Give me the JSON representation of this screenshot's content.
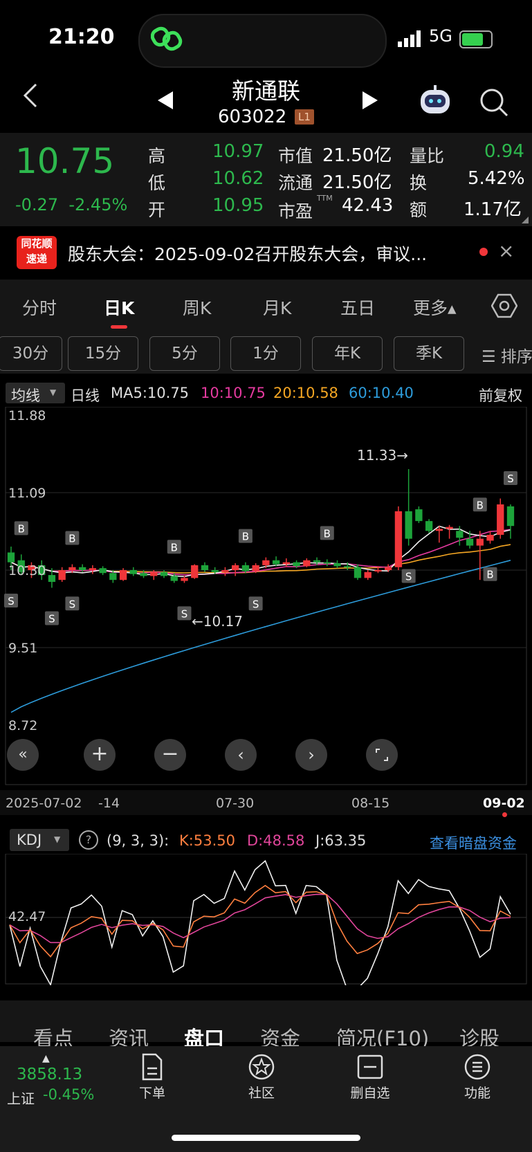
{
  "status_bar": {
    "time": "21:20",
    "network": "5G"
  },
  "header": {
    "title": "新通联",
    "code": "603022",
    "level_badge": "L1"
  },
  "quote": {
    "price": "10.75",
    "change": "-0.27",
    "change_pct": "-2.45%",
    "high_label": "高",
    "high": "10.97",
    "low_label": "低",
    "low": "10.62",
    "open_label": "开",
    "open": "10.95",
    "mcap_label": "市值",
    "mcap": "21.50亿",
    "float_label": "流通",
    "float": "21.50亿",
    "pe_label": "市盈",
    "pe_sup": "TTM",
    "pe": "42.43",
    "vol_ratio_label": "量比",
    "vol_ratio": "0.94",
    "turnover_label": "换",
    "turnover": "5.42%",
    "amount_label": "额",
    "amount": "1.17亿"
  },
  "news": {
    "logo_line1": "同花顺",
    "logo_line2": "速递",
    "text": "股东大会：2025-09-02召开股东大会，审议..."
  },
  "period_tabs": [
    "分时",
    "日K",
    "周K",
    "月K",
    "五日",
    "更多▴"
  ],
  "sub_tabs": [
    "30分",
    "15分",
    "5分",
    "1分",
    "年K",
    "季K",
    "☰ 排序"
  ],
  "ma_row": {
    "indicator": "均线",
    "period": "日线",
    "ma5": "MA5:10.75",
    "ma10": "10:10.75",
    "ma20": "20:10.58",
    "ma60": "60:10.40",
    "adjust": "前复权"
  },
  "colors": {
    "up": "#f0363a",
    "down": "#1da33a",
    "ma5": "#f0f0f0",
    "ma10": "#e63aa0",
    "ma20": "#f5a623",
    "ma60": "#2d9cdb",
    "k": "#ff7f3f",
    "d": "#e0459a",
    "j": "#f0f0f0"
  },
  "kdj_row": {
    "indicator": "KDJ",
    "params": "(9, 3, 3):",
    "k": "K:53.50",
    "d": "D:48.58",
    "j": "J:63.35",
    "link": "查看暗盘资金"
  },
  "chart_data": {
    "type": "candlestick",
    "price_axis": {
      "ticks": [
        "11.88",
        "11.09",
        "10.30",
        "9.51",
        "8.72"
      ],
      "ylim": [
        8.72,
        11.88
      ]
    },
    "date_labels": [
      "2025-07-02",
      "-14",
      "07-30",
      "08-15",
      "09-02"
    ],
    "annotations": {
      "high": "11.33→",
      "low": "←10.17"
    },
    "markers": [
      "S",
      "B",
      "S",
      "B",
      "S",
      "B",
      "S",
      "B",
      "S",
      "B",
      "S",
      "B",
      "B",
      "S"
    ],
    "candles": [
      [
        10.48,
        10.54,
        10.3,
        10.38
      ],
      [
        10.4,
        10.46,
        10.25,
        10.28
      ],
      [
        10.3,
        10.38,
        10.22,
        10.35
      ],
      [
        10.35,
        10.4,
        10.2,
        10.25
      ],
      [
        10.25,
        10.32,
        10.12,
        10.18
      ],
      [
        10.2,
        10.33,
        10.18,
        10.3
      ],
      [
        10.3,
        10.36,
        10.27,
        10.33
      ],
      [
        10.33,
        10.36,
        10.28,
        10.3
      ],
      [
        10.3,
        10.35,
        10.26,
        10.32
      ],
      [
        10.32,
        10.34,
        10.25,
        10.27
      ],
      [
        10.27,
        10.3,
        10.17,
        10.2
      ],
      [
        10.2,
        10.32,
        10.19,
        10.3
      ],
      [
        10.3,
        10.33,
        10.24,
        10.26
      ],
      [
        10.27,
        10.3,
        10.22,
        10.24
      ],
      [
        10.24,
        10.3,
        10.2,
        10.28
      ],
      [
        10.28,
        10.3,
        10.22,
        10.24
      ],
      [
        10.24,
        10.27,
        10.17,
        10.19
      ],
      [
        10.19,
        10.24,
        10.17,
        10.22
      ],
      [
        10.22,
        10.36,
        10.21,
        10.35
      ],
      [
        10.35,
        10.38,
        10.28,
        10.3
      ],
      [
        10.3,
        10.33,
        10.26,
        10.28
      ],
      [
        10.28,
        10.33,
        10.24,
        10.3
      ],
      [
        10.3,
        10.37,
        10.24,
        10.35
      ],
      [
        10.35,
        10.38,
        10.27,
        10.29
      ],
      [
        10.29,
        10.37,
        10.27,
        10.35
      ],
      [
        10.35,
        10.43,
        10.32,
        10.4
      ],
      [
        10.4,
        10.44,
        10.34,
        10.36
      ],
      [
        10.36,
        10.42,
        10.33,
        10.38
      ],
      [
        10.38,
        10.4,
        10.32,
        10.34
      ],
      [
        10.34,
        10.42,
        10.33,
        10.4
      ],
      [
        10.4,
        10.43,
        10.35,
        10.38
      ],
      [
        10.38,
        10.41,
        10.34,
        10.37
      ],
      [
        10.37,
        10.4,
        10.32,
        10.34
      ],
      [
        10.34,
        10.38,
        10.3,
        10.33
      ],
      [
        10.33,
        10.36,
        10.2,
        10.22
      ],
      [
        10.22,
        10.3,
        10.2,
        10.28
      ],
      [
        10.3,
        10.34,
        10.27,
        10.3
      ],
      [
        10.3,
        10.36,
        10.28,
        10.33
      ],
      [
        10.33,
        10.95,
        10.3,
        10.9
      ],
      [
        10.9,
        11.33,
        10.55,
        10.62
      ],
      [
        10.92,
        10.95,
        10.78,
        10.8
      ],
      [
        10.8,
        10.82,
        10.68,
        10.7
      ],
      [
        10.7,
        10.75,
        10.58,
        10.72
      ],
      [
        10.72,
        10.76,
        10.62,
        10.74
      ],
      [
        10.7,
        10.75,
        10.55,
        10.63
      ],
      [
        10.62,
        10.7,
        10.52,
        10.55
      ],
      [
        10.55,
        10.7,
        10.2,
        10.62
      ],
      [
        10.6,
        10.7,
        10.57,
        10.66
      ],
      [
        10.66,
        11.03,
        10.62,
        10.97
      ],
      [
        10.95,
        10.97,
        10.62,
        10.75
      ]
    ],
    "ma60_endpoints": [
      8.85,
      10.4
    ],
    "kdj": {
      "mid_tick": "42.47"
    }
  },
  "bottom_tabs": [
    "看点",
    "资讯",
    "盘口",
    "资金",
    "简况(F10)",
    "诊股"
  ],
  "toolbar": {
    "index_value": "3858.13",
    "index_name": "上证",
    "index_change": "-0.45%",
    "items": [
      "下单",
      "社区",
      "删自选",
      "功能"
    ]
  }
}
